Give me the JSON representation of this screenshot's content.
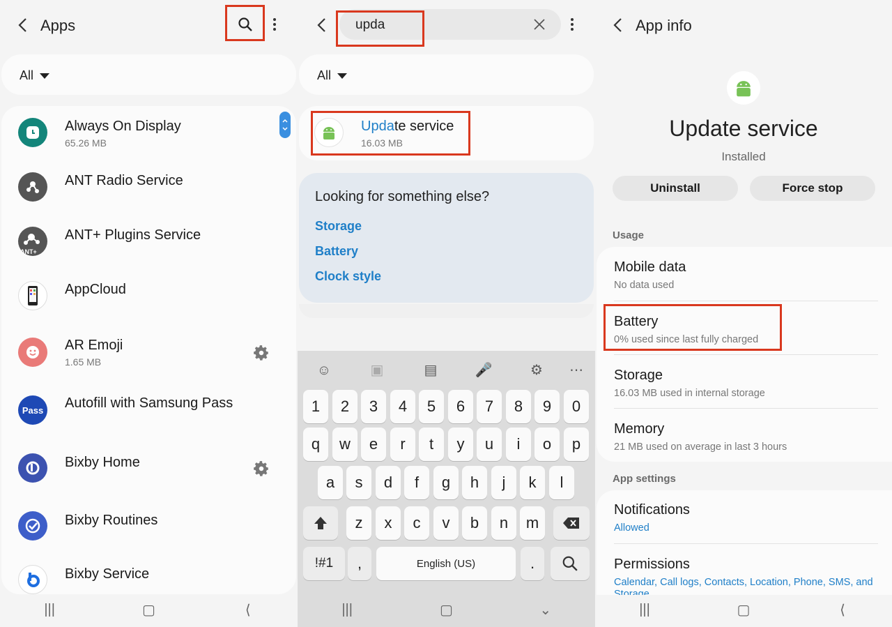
{
  "panel1": {
    "title": "Apps",
    "filter": "All",
    "apps": [
      {
        "name": "Always On Display",
        "size": "65.26 MB"
      },
      {
        "name": "ANT Radio Service",
        "size": ""
      },
      {
        "name": "ANT+ Plugins Service",
        "size": ""
      },
      {
        "name": "AppCloud",
        "size": ""
      },
      {
        "name": "AR Emoji",
        "size": "1.65 MB"
      },
      {
        "name": "Autofill with Samsung Pass",
        "size": ""
      },
      {
        "name": "Bixby Home",
        "size": ""
      },
      {
        "name": "Bixby Routines",
        "size": ""
      },
      {
        "name": "Bixby Service",
        "size": ""
      }
    ],
    "pass_icon_text": "Pass",
    "ant_icon_text": "ANT+"
  },
  "panel2": {
    "search_value": "upda",
    "filter": "All",
    "result": {
      "match": "Upda",
      "rest": "te service",
      "size": "16.03 MB"
    },
    "suggest": {
      "heading": "Looking for something else?",
      "links": [
        "Storage",
        "Battery",
        "Clock style"
      ]
    },
    "keyboard": {
      "row_numbers": [
        "1",
        "2",
        "3",
        "4",
        "5",
        "6",
        "7",
        "8",
        "9",
        "0"
      ],
      "row1": [
        "q",
        "w",
        "e",
        "r",
        "t",
        "y",
        "u",
        "i",
        "o",
        "p"
      ],
      "row2": [
        "a",
        "s",
        "d",
        "f",
        "g",
        "h",
        "j",
        "k",
        "l"
      ],
      "row3": [
        "z",
        "x",
        "c",
        "v",
        "b",
        "n",
        "m"
      ],
      "symbols_key": "!#1",
      "comma_key": ",",
      "space_key": "English (US)",
      "period_key": "."
    }
  },
  "panel3": {
    "title": "App info",
    "app_name": "Update service",
    "status": "Installed",
    "uninstall": "Uninstall",
    "force_stop": "Force stop",
    "usage_header": "Usage",
    "usage": [
      {
        "title": "Mobile data",
        "sub": "No data used"
      },
      {
        "title": "Battery",
        "sub": "0% used since last fully charged"
      },
      {
        "title": "Storage",
        "sub": "16.03 MB used in internal storage"
      },
      {
        "title": "Memory",
        "sub": "21 MB used on average in last 3 hours"
      }
    ],
    "app_settings_header": "App settings",
    "settings": [
      {
        "title": "Notifications",
        "sub": "Allowed"
      },
      {
        "title": "Permissions",
        "sub": "Calendar, Call logs, Contacts, Location, Phone, SMS, and Storage"
      }
    ]
  },
  "colors": {
    "accent_blue": "#1f7fc8",
    "highlight_red": "#d9381e",
    "android_green": "#78c257"
  }
}
